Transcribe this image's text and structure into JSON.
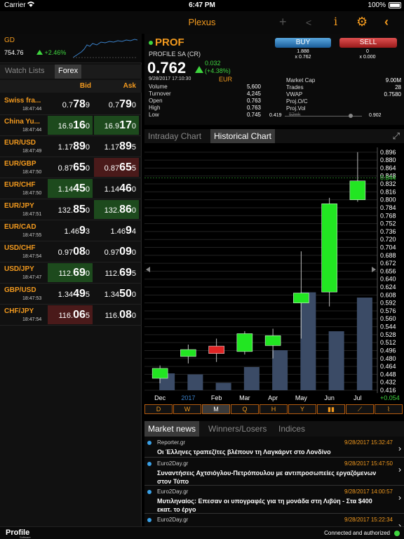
{
  "status": {
    "carrier": "Carrier",
    "time": "6:47 PM",
    "battery": "100%"
  },
  "app": {
    "title": "Plexus"
  },
  "index": {
    "name": "GD",
    "value": "754.76",
    "change": "+2.46%"
  },
  "left_tabs": [
    "Watch Lists",
    "Forex"
  ],
  "fx_headers": {
    "bid": "Bid",
    "ask": "Ask"
  },
  "fx": [
    {
      "name": "Swiss fra...",
      "time": "18:47:44",
      "bid_pre": "0.7",
      "bid_big": "78",
      "bid_post": "9",
      "ask_pre": "0.7",
      "ask_big": "79",
      "ask_post": "0",
      "bid_dir": "",
      "ask_dir": ""
    },
    {
      "name": "China Yu...",
      "time": "18:47:44",
      "bid_pre": "16.9",
      "bid_big": "16",
      "bid_post": "0",
      "ask_pre": "16.9",
      "ask_big": "17",
      "ask_post": "0",
      "bid_dir": "up",
      "ask_dir": "up"
    },
    {
      "name": "EUR/USD",
      "time": "18:47:49",
      "bid_pre": "1.17",
      "bid_big": "89",
      "bid_post": "0",
      "ask_pre": "1.17",
      "ask_big": "89",
      "ask_post": "5",
      "bid_dir": "",
      "ask_dir": ""
    },
    {
      "name": "EUR/GBP",
      "time": "18:47:50",
      "bid_pre": "0.87",
      "bid_big": "65",
      "bid_post": "0",
      "ask_pre": "0.87",
      "ask_big": "65",
      "ask_post": "5",
      "bid_dir": "",
      "ask_dir": "down"
    },
    {
      "name": "EUR/CHF",
      "time": "18:47:50",
      "bid_pre": "1.14",
      "bid_big": "45",
      "bid_post": "0",
      "ask_pre": "1.14",
      "ask_big": "46",
      "ask_post": "0",
      "bid_dir": "up",
      "ask_dir": ""
    },
    {
      "name": "EUR/JPY",
      "time": "18:47:51",
      "bid_pre": "132.",
      "bid_big": "85",
      "bid_post": "0",
      "ask_pre": "132.",
      "ask_big": "86",
      "ask_post": "0",
      "bid_dir": "",
      "ask_dir": "up"
    },
    {
      "name": "EUR/CAD",
      "time": "18:47:55",
      "bid_pre": "1.46",
      "bid_big": "9",
      "bid_post": "3",
      "ask_pre": "1.46",
      "ask_big": "9",
      "ask_post": "4",
      "bid_dir": "",
      "ask_dir": ""
    },
    {
      "name": "USD/CHF",
      "time": "18:47:54",
      "bid_pre": "0.97",
      "bid_big": "08",
      "bid_post": "0",
      "ask_pre": "0.97",
      "ask_big": "09",
      "ask_post": "0",
      "bid_dir": "",
      "ask_dir": ""
    },
    {
      "name": "USD/JPY",
      "time": "18:47:47",
      "bid_pre": "112.",
      "bid_big": "69",
      "bid_post": "0",
      "ask_pre": "112.",
      "ask_big": "69",
      "ask_post": "5",
      "bid_dir": "up",
      "ask_dir": ""
    },
    {
      "name": "GBP/USD",
      "time": "18:47:53",
      "bid_pre": "1.34",
      "bid_big": "49",
      "bid_post": "5",
      "ask_pre": "1.34",
      "ask_big": "50",
      "ask_post": "0",
      "bid_dir": "",
      "ask_dir": ""
    },
    {
      "name": "CHF/JPY",
      "time": "18:47:54",
      "bid_pre": "116.",
      "bid_big": "06",
      "bid_post": "5",
      "ask_pre": "116.",
      "ask_big": "08",
      "ask_post": "0",
      "bid_dir": "down",
      "ask_dir": ""
    }
  ],
  "quote": {
    "symbol": "PROF",
    "name": "PROFILE SA (CR)",
    "price": "0.762",
    "change": "0.032",
    "pct": "(+4.38%)",
    "datetime": "9/28/2017 17:10:30",
    "currency": "EUR",
    "buy_label": "BUY",
    "sell_label": "SELL",
    "buy_price": "1.888",
    "buy_qty": "x 0.762",
    "sell_price": "0",
    "sell_qty": "x 0.000",
    "stats_left": [
      {
        "k": "Volume",
        "v": "5,600"
      },
      {
        "k": "Turnover",
        "v": "4,245"
      },
      {
        "k": "Open",
        "v": "0.763"
      },
      {
        "k": "High",
        "v": "0.763"
      },
      {
        "k": "Low",
        "v": "0.745"
      }
    ],
    "stats_right": [
      {
        "k": "Market Cap",
        "v": "9.00M"
      },
      {
        "k": "Trades",
        "v": "28"
      },
      {
        "k": "VWAP",
        "v": "0.7580"
      },
      {
        "k": "Proj.O/C",
        "v": ""
      },
      {
        "k": "Proj.Vol",
        "v": ""
      }
    ],
    "range_lo": "0.419",
    "range_hi": "0.902",
    "range_label": "52wk",
    "range_position": 0.85
  },
  "chart_tabs": [
    "Intraday Chart",
    "Historical Chart"
  ],
  "chart_data": {
    "type": "candlestick",
    "categories": [
      "Dec",
      "2017",
      "Feb",
      "Mar",
      "Apr",
      "May",
      "Jun",
      "Jul"
    ],
    "ylim": [
      0.416,
      0.9
    ],
    "y_ticks": [
      "0.896",
      "0.880",
      "0.864",
      "0.848",
      "0.832",
      "0.816",
      "0.800",
      "0.784",
      "0.768",
      "0.752",
      "0.736",
      "0.720",
      "0.704",
      "0.688",
      "0.672",
      "0.656",
      "0.640",
      "0.624",
      "0.608",
      "0.592",
      "0.576",
      "0.560",
      "0.544",
      "0.528",
      "0.512",
      "0.496",
      "0.480",
      "0.464",
      "0.448",
      "0.432",
      "0.416"
    ],
    "highlight_tick": "0.844",
    "last_change": "+0.054",
    "candles": [
      {
        "o": 0.44,
        "h": 0.466,
        "l": 0.43,
        "c": 0.46,
        "dir": "up"
      },
      {
        "o": 0.484,
        "h": 0.508,
        "l": 0.47,
        "c": 0.498,
        "dir": "up"
      },
      {
        "o": 0.505,
        "h": 0.52,
        "l": 0.473,
        "c": 0.49,
        "dir": "down"
      },
      {
        "o": 0.494,
        "h": 0.535,
        "l": 0.488,
        "c": 0.53,
        "dir": "up"
      },
      {
        "o": 0.506,
        "h": 0.54,
        "l": 0.48,
        "c": 0.526,
        "dir": "up"
      },
      {
        "o": 0.592,
        "h": 0.696,
        "l": 0.52,
        "c": 0.612,
        "dir": "up"
      },
      {
        "o": 0.614,
        "h": 0.804,
        "l": 0.585,
        "c": 0.792,
        "dir": "up"
      },
      {
        "o": 0.8,
        "h": 0.896,
        "l": 0.796,
        "c": 0.838,
        "dir": "up"
      }
    ],
    "volumes": [
      0.16,
      0.15,
      0.07,
      0.22,
      0.38,
      0.93,
      0.56,
      0.88
    ]
  },
  "periods": [
    "D",
    "W",
    "M",
    "Q",
    "H",
    "Y",
    "▮▮",
    "⟋",
    "⌇"
  ],
  "period_active": "M",
  "news_tabs": [
    "Market news",
    "Winners/Losers",
    "Indices"
  ],
  "news": [
    {
      "source": "Reporter.gr",
      "time": "9/28/2017 15:32:47",
      "headline": "Οι Έλληνες τραπεζίτες βλέπουν τη Λαγκάρντ στο Λονδίνο"
    },
    {
      "source": "Euro2Day.gr",
      "time": "9/28/2017 15:47:50",
      "headline": "Συναντήσεις Αχτσιόγλου-Πετρόπουλου με αντιπροσωπείες εργαζόμενων στον Τύπο"
    },
    {
      "source": "Euro2Day.gr",
      "time": "9/28/2017 14:00:57",
      "headline": "Μυτιληναίος: Επεσαν οι υπογραφές για τη μονάδα στη Λιβύη - Στα $400 εκατ. το έργο"
    },
    {
      "source": "Euro2Day.gr",
      "time": "9/28/2017 15:22:34",
      "headline": ""
    }
  ],
  "footer": {
    "logo": "Profile",
    "logo_sub": "Software",
    "connection": "Connected and authorized"
  },
  "colors": {
    "accent": "#f39a1e",
    "up": "#3fd53f",
    "down": "#e02424",
    "candle_up": "#22e622",
    "candle_down": "#e02424",
    "volume": "#3b4b66"
  }
}
